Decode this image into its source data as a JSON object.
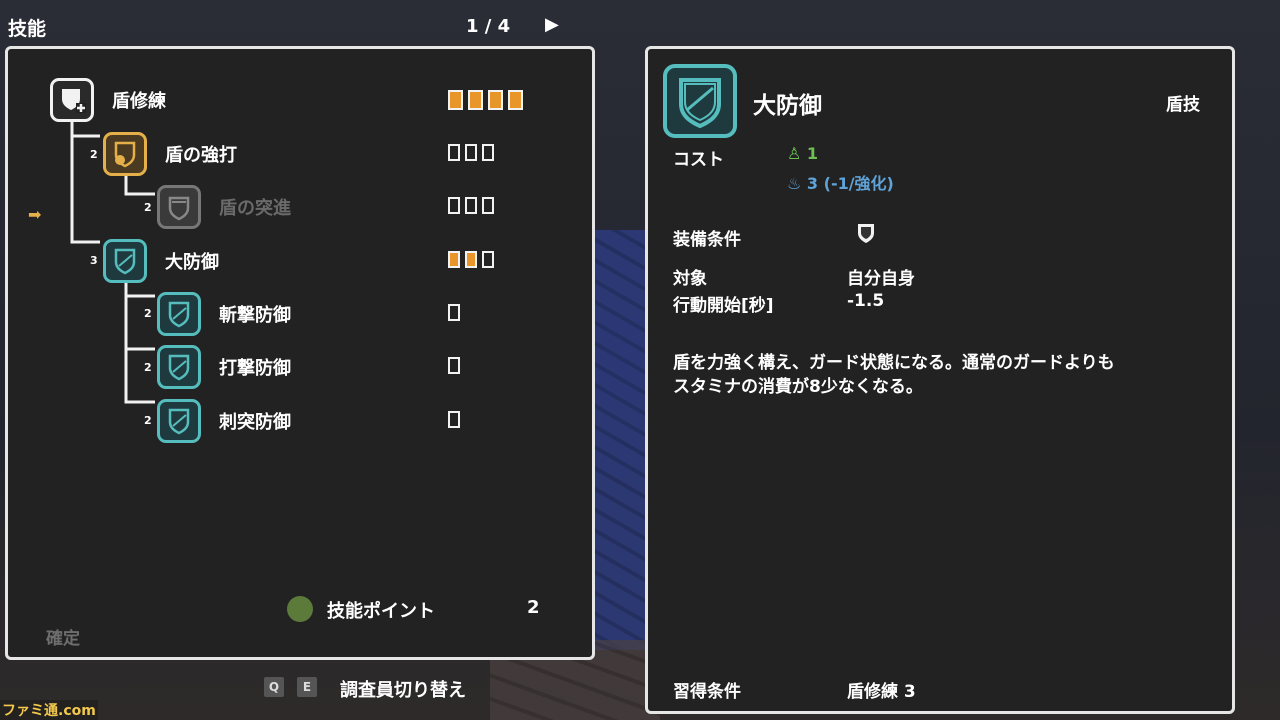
{
  "header": {
    "title": "技能",
    "page": "1 / 4",
    "next_icon": "play-arrow-icon"
  },
  "tree": {
    "nodes": [
      {
        "id": "tate-shuren",
        "label": "盾修練",
        "level": "",
        "icon": "shield-plus-icon",
        "style": "white",
        "pips_total": 4,
        "pips_filled": 4
      },
      {
        "id": "tate-no-kyoda",
        "label": "盾の強打",
        "level": "2",
        "icon": "shield-bash-icon",
        "style": "gold",
        "pips_total": 3,
        "pips_filled": 0
      },
      {
        "id": "tate-no-totsushin",
        "label": "盾の突進",
        "level": "2",
        "icon": "shield-charge-icon",
        "style": "gray",
        "pips_total": 3,
        "pips_filled": 0
      },
      {
        "id": "dai-bogyo",
        "label": "大防御",
        "level": "3",
        "icon": "shield-slash-icon",
        "style": "teal",
        "pips_total": 3,
        "pips_filled": 2
      },
      {
        "id": "zangeki-bogyo",
        "label": "斬撃防御",
        "level": "2",
        "icon": "shield-slash-defense-icon",
        "style": "teal",
        "pips_total": 1,
        "pips_filled": 0
      },
      {
        "id": "dageki-bogyo",
        "label": "打撃防御",
        "level": "2",
        "icon": "shield-blunt-defense-icon",
        "style": "teal",
        "pips_total": 1,
        "pips_filled": 0
      },
      {
        "id": "shitotsu-bogyo",
        "label": "刺突防御",
        "level": "2",
        "icon": "shield-pierce-defense-icon",
        "style": "teal",
        "pips_total": 1,
        "pips_filled": 0
      }
    ]
  },
  "skill_points": {
    "label": "技能ポイント",
    "value": "2",
    "icon": "goblin-head-icon"
  },
  "confirm_label": "確定",
  "footer": {
    "key_q": "Q",
    "key_e": "E",
    "label": "調査員切り替え"
  },
  "detail": {
    "name": "大防御",
    "type": "盾技",
    "cost_label": "コスト",
    "cost_stamina": "1",
    "cost_mana": "3 (-1/強化)",
    "equip_label": "装備条件",
    "equip_icon": "shield-icon",
    "target_label": "対象",
    "target_value": "自分自身",
    "start_label": "行動開始[秒]",
    "start_value": "-1.5",
    "description_line1": "盾を力強く構え、ガード状態になる。通常のガードよりも",
    "description_line2": "スタミナの消費が8少なくなる。",
    "learn_label": "習得条件",
    "learn_value": "盾修練 3"
  },
  "watermark": "ファミ通.com",
  "colors": {
    "gold": "#e5b04a",
    "teal": "#55bdbd",
    "pip_fill": "#e8952a",
    "stamina": "#6dc153",
    "mana": "#5fa3d8"
  }
}
